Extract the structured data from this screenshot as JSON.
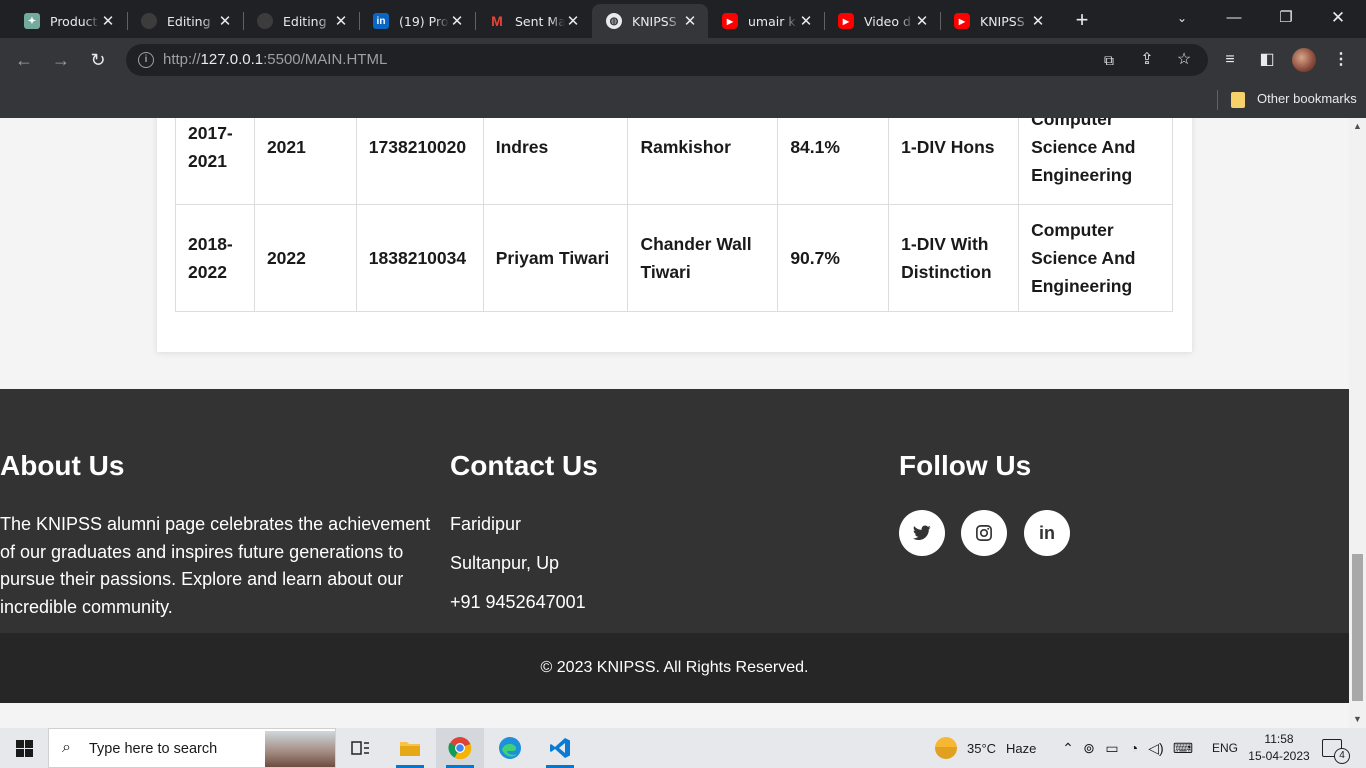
{
  "browser": {
    "tabs": [
      {
        "title": "Product",
        "favicon": "chatgpt-icon",
        "color": "#74aa9c"
      },
      {
        "title": "Editing",
        "favicon": "github-icon",
        "color": "#24292f"
      },
      {
        "title": "Editing",
        "favicon": "github-icon",
        "color": "#24292f"
      },
      {
        "title": "(19) Pro",
        "favicon": "linkedin-icon",
        "color": "#0a66c2"
      },
      {
        "title": "Sent Ma",
        "favicon": "gmail-icon",
        "color": "#ea4335"
      },
      {
        "title": "KNIPSS",
        "favicon": "globe-icon",
        "color": "#e8eaed"
      },
      {
        "title": "umair k",
        "favicon": "youtube-icon",
        "color": "#ff0000"
      },
      {
        "title": "Video d",
        "favicon": "youtube-icon",
        "color": "#ff0000"
      },
      {
        "title": "KNIPSS",
        "favicon": "youtube-icon",
        "color": "#ff0000"
      }
    ],
    "active_tab_index": 5,
    "url_scheme": "http://",
    "url_host": "127.0.0.1",
    "url_rest": ":5500/MAIN.HTML",
    "bookmarks_label": "Other bookmarks"
  },
  "results_table": {
    "rows": [
      {
        "session": "2017-2021",
        "year": "2021",
        "roll": "1738210020",
        "name": "Indres",
        "father": "Ramkishor",
        "percent": "84.1%",
        "division": "1-DIV Hons",
        "branch": "Computer Science And Engineering"
      },
      {
        "session": "2018-2022",
        "year": "2022",
        "roll": "1838210034",
        "name": "Priyam Tiwari",
        "father": "Chander Wall Tiwari",
        "percent": "90.7%",
        "division": "1-DIV With Distinction",
        "branch": "Computer Science And Engineering"
      }
    ]
  },
  "footer": {
    "about": {
      "heading": "About Us",
      "text": "The KNIPSS alumni page celebrates the achievement of our graduates and inspires future generations to pursue their passions. Explore and learn about our incredible community."
    },
    "contact": {
      "heading": "Contact Us",
      "line1": "Faridipur",
      "line2": "Sultanpur, Up",
      "line3": "+91 9452647001"
    },
    "follow": {
      "heading": "Follow Us",
      "icons": [
        "twitter-icon",
        "instagram-icon",
        "linkedin-icon"
      ]
    },
    "copyright": "© 2023 KNIPSS. All Rights Reserved."
  },
  "taskbar": {
    "search_placeholder": "Type here to search",
    "weather_temp": "35°C",
    "weather_desc": "Haze",
    "language": "ENG",
    "time": "11:58",
    "date": "15-04-2023",
    "notification_count": "4"
  }
}
